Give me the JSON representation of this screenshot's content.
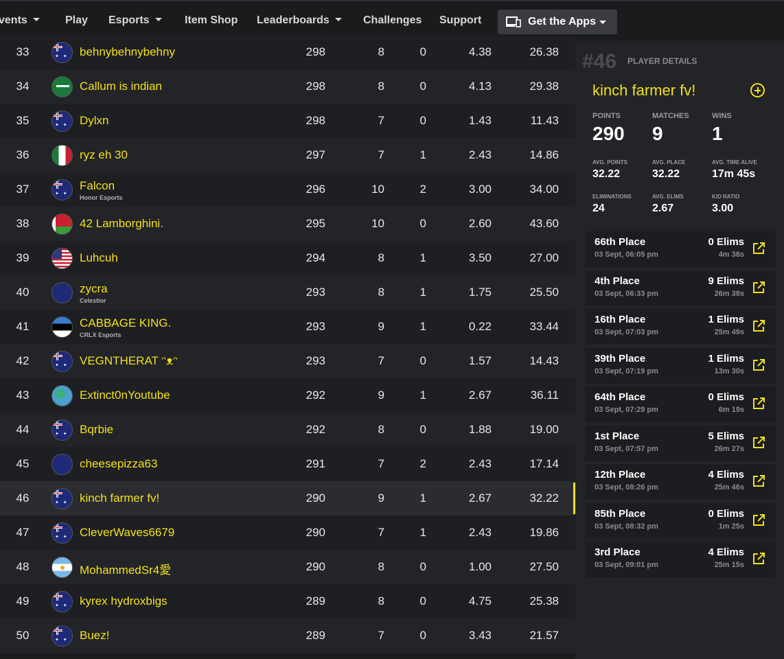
{
  "nav": {
    "items": [
      {
        "label": "vents",
        "dropdown": true
      },
      {
        "label": "Play",
        "dropdown": false
      },
      {
        "label": "Esports",
        "dropdown": true
      },
      {
        "label": "Item Shop",
        "dropdown": false
      },
      {
        "label": "Leaderboards",
        "dropdown": true
      },
      {
        "label": "Challenges",
        "dropdown": false
      },
      {
        "label": "Support",
        "dropdown": false
      }
    ],
    "apps_button": "Get the Apps",
    "accent_color": "#f2e01d"
  },
  "leaderboard": {
    "rows": [
      {
        "rank": "33",
        "flag": "au",
        "name": "behnybehnybehny",
        "team": "",
        "points": "298",
        "matches": "8",
        "wins": "0",
        "kd": "4.38",
        "avg": "26.38"
      },
      {
        "rank": "34",
        "flag": "sa",
        "name": "Callum is indian",
        "team": "",
        "points": "298",
        "matches": "8",
        "wins": "0",
        "kd": "4.13",
        "avg": "29.38"
      },
      {
        "rank": "35",
        "flag": "au",
        "name": "Dylxn",
        "team": "",
        "points": "298",
        "matches": "7",
        "wins": "0",
        "kd": "1.43",
        "avg": "11.43"
      },
      {
        "rank": "36",
        "flag": "mx",
        "name": "ryz eh 30",
        "team": "",
        "points": "297",
        "matches": "7",
        "wins": "1",
        "kd": "2.43",
        "avg": "14.86"
      },
      {
        "rank": "37",
        "flag": "au",
        "name": "Falcon",
        "team": "Honor Esports",
        "points": "296",
        "matches": "10",
        "wins": "2",
        "kd": "3.00",
        "avg": "34.00"
      },
      {
        "rank": "38",
        "flag": "by",
        "name": "42 Lamborghini.",
        "team": "",
        "points": "295",
        "matches": "10",
        "wins": "0",
        "kd": "2.60",
        "avg": "43.60"
      },
      {
        "rank": "39",
        "flag": "us",
        "name": "Luhcuh",
        "team": "",
        "points": "294",
        "matches": "8",
        "wins": "1",
        "kd": "3.50",
        "avg": "27.00"
      },
      {
        "rank": "40",
        "flag": "nz",
        "name": "zycra",
        "team": "Celestior",
        "points": "293",
        "matches": "8",
        "wins": "1",
        "kd": "1.75",
        "avg": "25.50"
      },
      {
        "rank": "41",
        "flag": "ee",
        "name": "CABBAGE KING.",
        "team": "CRLX Esports",
        "points": "293",
        "matches": "9",
        "wins": "1",
        "kd": "0.22",
        "avg": "33.44"
      },
      {
        "rank": "42",
        "flag": "au",
        "name": "VEGNTHERAT ᵔᴥᵔ",
        "team": "",
        "points": "293",
        "matches": "7",
        "wins": "0",
        "kd": "1.57",
        "avg": "14.43"
      },
      {
        "rank": "43",
        "flag": "un",
        "name": "Extinct0nYoutube",
        "team": "",
        "points": "292",
        "matches": "9",
        "wins": "1",
        "kd": "2.67",
        "avg": "36.11"
      },
      {
        "rank": "44",
        "flag": "au",
        "name": "Bqrbie",
        "team": "",
        "points": "292",
        "matches": "8",
        "wins": "0",
        "kd": "1.88",
        "avg": "19.00"
      },
      {
        "rank": "45",
        "flag": "nz",
        "name": "cheesepizza63",
        "team": "",
        "points": "291",
        "matches": "7",
        "wins": "2",
        "kd": "2.43",
        "avg": "17.14"
      },
      {
        "rank": "46",
        "flag": "au",
        "name": "kinch farmer fv!",
        "team": "",
        "points": "290",
        "matches": "9",
        "wins": "1",
        "kd": "2.67",
        "avg": "32.22",
        "selected": true
      },
      {
        "rank": "47",
        "flag": "au",
        "name": "CleverWaves6679",
        "team": "",
        "points": "290",
        "matches": "7",
        "wins": "1",
        "kd": "2.43",
        "avg": "19.86"
      },
      {
        "rank": "48",
        "flag": "ar",
        "name": "MohammedSr4愛",
        "team": "",
        "points": "290",
        "matches": "8",
        "wins": "0",
        "kd": "1.00",
        "avg": "27.50"
      },
      {
        "rank": "49",
        "flag": "au",
        "name": "kyrex hydroxbigs",
        "team": "",
        "points": "289",
        "matches": "8",
        "wins": "0",
        "kd": "4.75",
        "avg": "25.38"
      },
      {
        "rank": "50",
        "flag": "au",
        "name": "Buez!",
        "team": "",
        "points": "289",
        "matches": "7",
        "wins": "0",
        "kd": "3.43",
        "avg": "21.57"
      }
    ]
  },
  "player": {
    "rank": "#46",
    "title": "PLAYER DETAILS",
    "name": "kinch farmer fv!",
    "points_label": "POINTS",
    "points": "290",
    "matches_label": "MATCHES",
    "matches": "9",
    "wins_label": "WINS",
    "wins": "1",
    "avg_points_label": "AVG. POINTS",
    "avg_points": "32.22",
    "avg_place_label": "AVG. PLACE",
    "avg_place": "32.22",
    "avg_time_label": "AVG. TIME ALIVE",
    "avg_time": "17m 45s",
    "elims_label": "ELIMINATIONS",
    "elims": "24",
    "avg_elims_label": "AVG. ELIMS",
    "avg_elims": "2.67",
    "kd_label": "K/D RATIO",
    "kd": "3.00",
    "matches_list": [
      {
        "place": "66th Place",
        "date": "03 Sept, 06:05 pm",
        "elims": "0 Elims",
        "time": "4m 38s"
      },
      {
        "place": "4th Place",
        "date": "03 Sept, 06:33 pm",
        "elims": "9 Elims",
        "time": "26m 38s"
      },
      {
        "place": "16th Place",
        "date": "03 Sept, 07:03 pm",
        "elims": "1 Elims",
        "time": "25m 49s"
      },
      {
        "place": "39th Place",
        "date": "03 Sept, 07:19 pm",
        "elims": "1 Elims",
        "time": "13m 30s"
      },
      {
        "place": "64th Place",
        "date": "03 Sept, 07:29 pm",
        "elims": "0 Elims",
        "time": "6m 19s"
      },
      {
        "place": "1st Place",
        "date": "03 Sept, 07:57 pm",
        "elims": "5 Elims",
        "time": "26m 27s"
      },
      {
        "place": "12th Place",
        "date": "03 Sept, 08:26 pm",
        "elims": "4 Elims",
        "time": "25m 46s"
      },
      {
        "place": "85th Place",
        "date": "03 Sept, 08:32 pm",
        "elims": "0 Elims",
        "time": "1m 25s"
      },
      {
        "place": "3rd Place",
        "date": "03 Sept, 09:01 pm",
        "elims": "4 Elims",
        "time": "25m 15s"
      }
    ]
  }
}
